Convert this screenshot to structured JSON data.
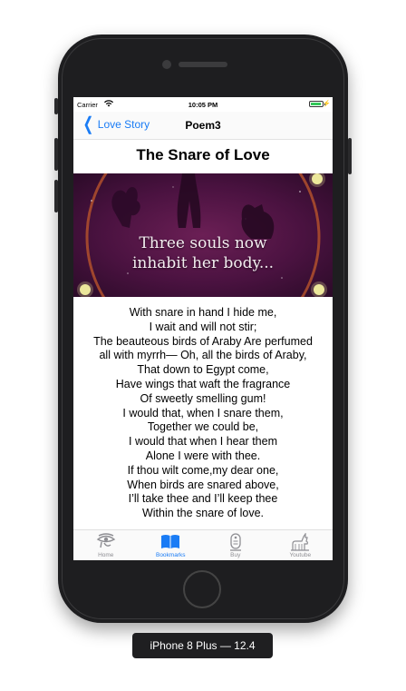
{
  "status_bar": {
    "carrier": "Carrier",
    "time": "10:05 PM",
    "battery_level": 0.9
  },
  "nav": {
    "back_label": "Love Story",
    "title": "Poem3"
  },
  "poem": {
    "title": "The Snare of Love",
    "banner_text": [
      "Three souls now",
      "inhabit her body..."
    ],
    "lines": [
      "With snare in hand I hide me,",
      "I wait and will not stir;",
      "The beauteous birds of Araby Are perfumed",
      "all with myrrh— Oh, all the birds of Araby,",
      "That down to Egypt come,",
      "Have wings that waft the fragrance",
      "Of sweetly smelling gum!",
      "I would that, when I snare them,",
      "Together we could be,",
      "I would that when I hear them",
      "Alone I were with thee.",
      "If thou wilt come,my dear one,",
      "When birds are snared above,",
      "I’ll take thee and I’ll keep thee",
      "Within the snare of love."
    ]
  },
  "tabs": [
    {
      "label": "Home",
      "icon": "eye-of-horus-icon",
      "active": false
    },
    {
      "label": "Bookmarks",
      "icon": "book-icon",
      "active": true
    },
    {
      "label": "Buy",
      "icon": "cartouche-icon",
      "active": false
    },
    {
      "label": "Youtube",
      "icon": "anubis-icon",
      "active": false
    }
  ],
  "colors": {
    "accent": "#1a7cf5",
    "inactive_tab": "#8e8e93",
    "battery": "#33c759"
  },
  "device_label": "iPhone 8 Plus — 12.4"
}
